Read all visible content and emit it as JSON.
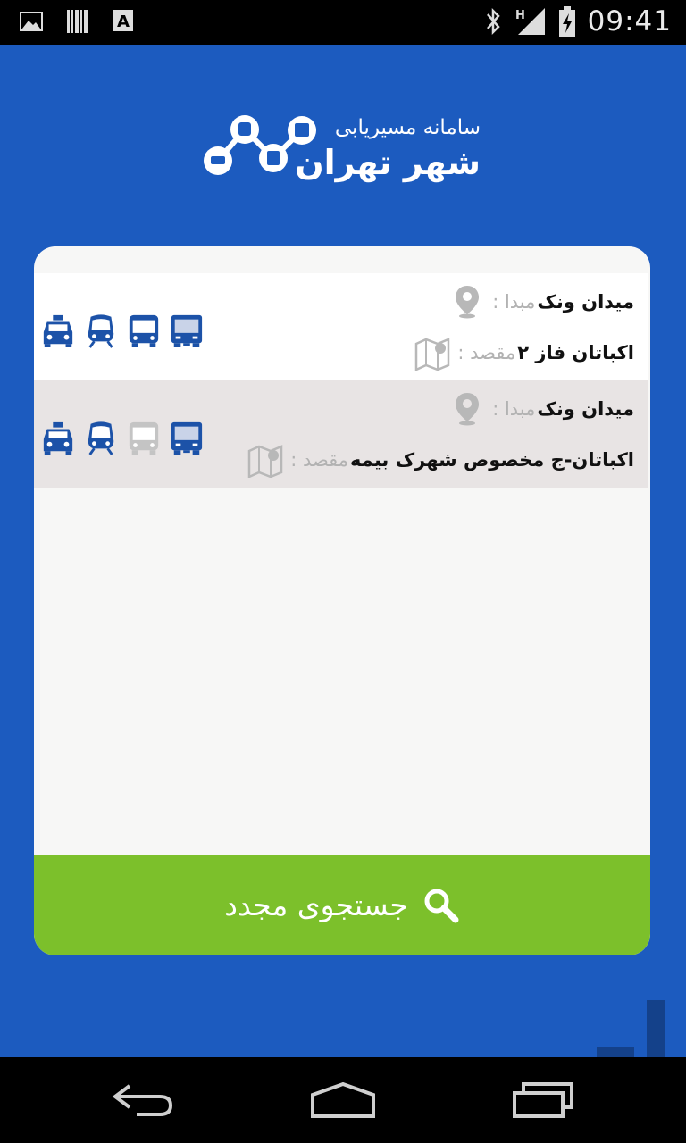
{
  "status_bar": {
    "time": "09:41",
    "left_icons": [
      "image-icon",
      "barcode-icon",
      "font-icon"
    ],
    "right_icons": [
      "bluetooth-icon",
      "signal-icon",
      "battery-charging-icon"
    ],
    "network_type": "H"
  },
  "header": {
    "subtitle": "سامانه مسیریابی",
    "title": "شهر تهران"
  },
  "routes": [
    {
      "origin_label": "مبدا :",
      "origin_value": "میدان ونک",
      "dest_label": "مقصد :",
      "dest_value": "اکباتان فاز ۲",
      "modes": [
        {
          "icon": "taxi-icon",
          "active": true
        },
        {
          "icon": "metro-icon",
          "active": true
        },
        {
          "icon": "bus-icon",
          "active": true
        },
        {
          "icon": "brt-icon",
          "active": true
        }
      ]
    },
    {
      "origin_label": "مبدا :",
      "origin_value": "میدان ونک",
      "dest_label": "مقصد :",
      "dest_value": "اکباتان-ج مخصوص شهرک بیمه",
      "modes": [
        {
          "icon": "taxi-icon",
          "active": true
        },
        {
          "icon": "metro-icon",
          "active": true
        },
        {
          "icon": "bus-icon",
          "active": false
        },
        {
          "icon": "brt-icon",
          "active": true
        }
      ]
    }
  ],
  "search_again": {
    "label": "جستجوی مجدد"
  },
  "colors": {
    "background": "#1c5bbf",
    "mode_active": "#1c52a8",
    "mode_inactive": "#c4c4c4",
    "button": "#7cc02b"
  }
}
